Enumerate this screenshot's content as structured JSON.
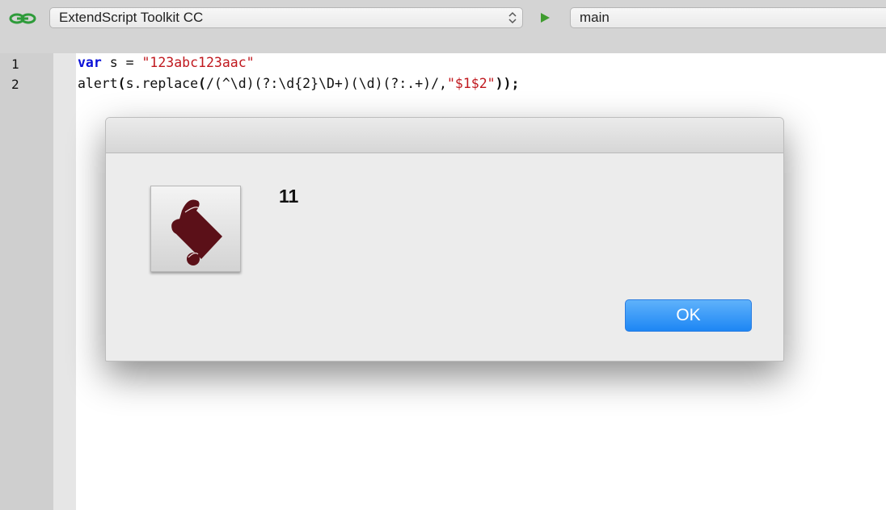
{
  "toolbar": {
    "target_app": "ExtendScript Toolkit CC",
    "engine": "main",
    "icons": [
      "link-icon",
      "run-icon",
      "select-arrows-icon"
    ]
  },
  "editor": {
    "line_numbers": [
      "1",
      "2"
    ],
    "line1": {
      "keyword": "var",
      "text": " s = ",
      "string": "\"123abc123aac\""
    },
    "line2": {
      "prefix": "alert",
      "open_paren": "(",
      "call": "s.replace",
      "open_paren2": "(",
      "regex": "/(^\\d)(?:\\d{2}\\D+)(\\d)(?:.+)/,",
      "string": "\"$1$2\"",
      "close": "));"
    }
  },
  "dialog": {
    "message": "11",
    "ok_label": "OK",
    "icon": "extendscript-scroll-icon",
    "accent": "#1d86f4"
  }
}
